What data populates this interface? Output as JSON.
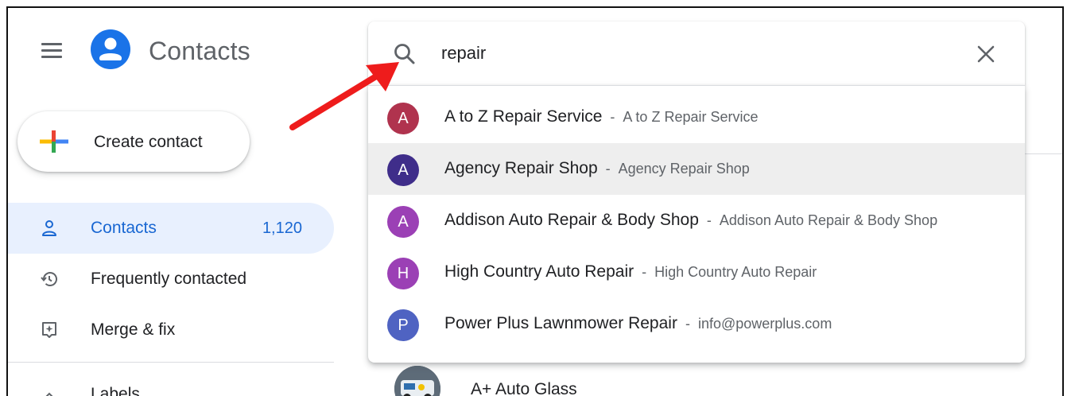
{
  "header": {
    "title": "Contacts",
    "menu_icon": "hamburger-menu-icon",
    "logo_icon": "person-icon",
    "logo_color": "#1a73e8"
  },
  "create_button": {
    "label": "Create contact",
    "icon": "plus-icon"
  },
  "sidebar": {
    "items": [
      {
        "label": "Contacts",
        "count": "1,120",
        "icon": "person-icon",
        "active": true
      },
      {
        "label": "Frequently contacted",
        "icon": "history-icon"
      },
      {
        "label": "Merge & fix",
        "icon": "merge-fix-icon"
      },
      {
        "label": "Labels",
        "icon": "chevron-icon"
      }
    ]
  },
  "search": {
    "value": "repair",
    "icon": "search-icon",
    "clear_icon": "close-icon",
    "results": [
      {
        "initial": "A",
        "name": "A to Z Repair Service",
        "separator": "-",
        "detail": "A to Z Repair Service",
        "color": "#b0334e"
      },
      {
        "initial": "A",
        "name": "Agency Repair Shop",
        "separator": "-",
        "detail": "Agency Repair Shop",
        "color": "#3f2d8a",
        "hovered": true
      },
      {
        "initial": "A",
        "name": "Addison Auto Repair & Body Shop",
        "separator": "-",
        "detail": "Addison Auto Repair & Body Shop",
        "color": "#9b40b5"
      },
      {
        "initial": "H",
        "name": "High Country Auto Repair",
        "separator": "-",
        "detail": "High Country Auto Repair",
        "color": "#9b40b5"
      },
      {
        "initial": "P",
        "name": "Power Plus Lawnmower Repair",
        "separator": "-",
        "detail": "info@powerplus.com",
        "color": "#4f63c2"
      }
    ]
  },
  "list": {
    "partial_contact_name": "A+ Auto Glass"
  },
  "annotation": {
    "arrow_color": "#ee1c1c"
  }
}
